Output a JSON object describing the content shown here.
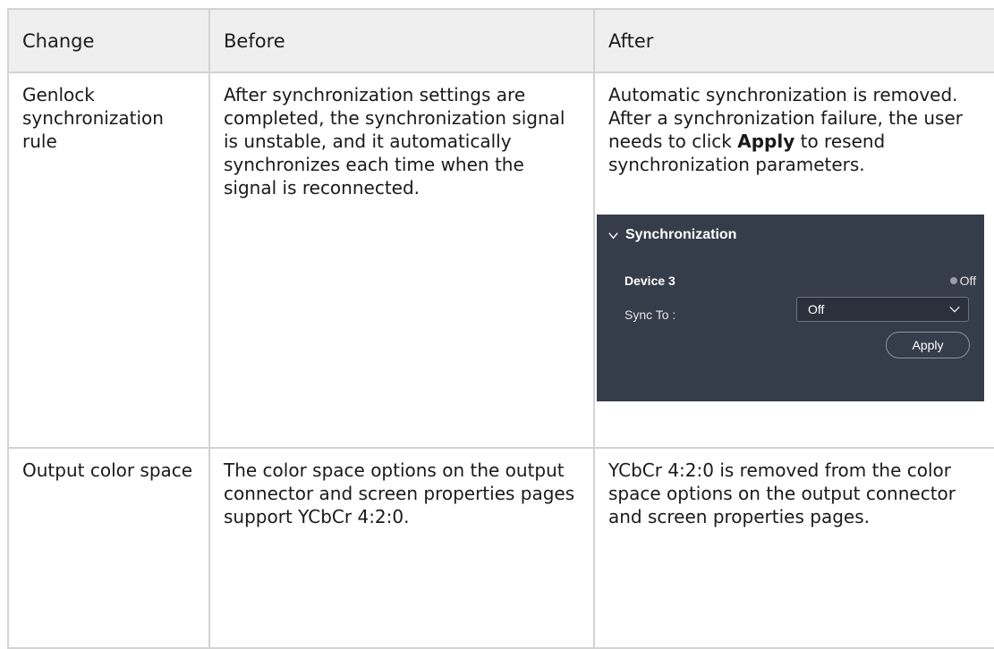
{
  "table": {
    "headers": [
      "Change",
      "Before",
      "After"
    ],
    "rows": [
      {
        "change": "Genlock synchronization rule",
        "before": "After synchronization settings are completed, the synchronization signal is unstable, and it automatically synchronizes each time when the signal is reconnected.",
        "after_part1": "Automatic synchronization is removed. After a synchronization failure, the user needs to click ",
        "after_bold": "Apply",
        "after_part2": " to resend synchronization parameters."
      },
      {
        "change": "Output color space",
        "before": "The color space options on the output connector and screen properties pages support YCbCr 4:2:0.",
        "after": "YCbCr 4:2:0 is removed from the color space options on the output connector and screen properties pages."
      }
    ]
  },
  "sync_panel": {
    "title": "Synchronization",
    "device": "Device 3",
    "status": "Off",
    "sync_label": "Sync To :",
    "sync_value": "Off",
    "apply_label": "Apply",
    "colors": {
      "background": "#353c4a",
      "status_dot": "#9a9ea6"
    },
    "icons": {
      "collapse": "chevron-down-icon",
      "dropdown": "chevron-down-icon",
      "status": "status-dot-icon"
    }
  }
}
